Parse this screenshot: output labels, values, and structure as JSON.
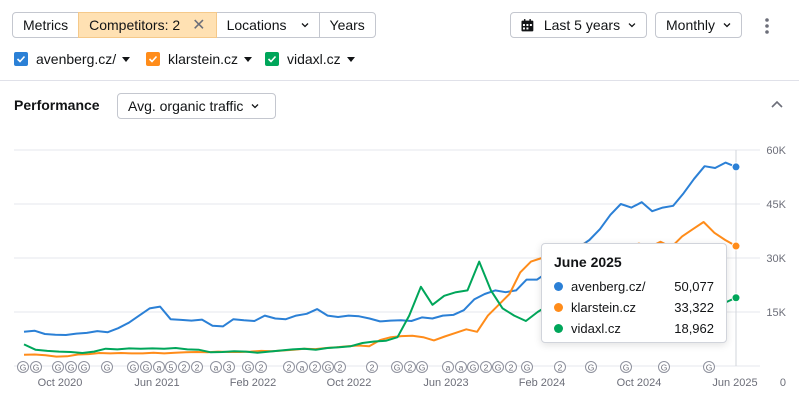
{
  "toolbar": {
    "tabs": [
      {
        "label": "Metrics"
      },
      {
        "label": "Competitors: 2"
      },
      {
        "label": "Locations"
      },
      {
        "label": "Years"
      }
    ],
    "period_label": "Last 5 years",
    "granularity_label": "Monthly"
  },
  "competitors": [
    {
      "label": "avenberg.cz/",
      "color": "#2b80d6"
    },
    {
      "label": "klarstein.cz",
      "color": "#ff8c1a"
    },
    {
      "label": "vidaxl.cz",
      "color": "#00a65a"
    }
  ],
  "performance": {
    "title": "Performance",
    "metric_label": "Avg. organic traffic"
  },
  "chart_data": {
    "type": "line",
    "x_tick_labels": [
      "Oct 2020",
      "Jun 2021",
      "Feb 2022",
      "Oct 2022",
      "Jun 2023",
      "Feb 2024",
      "Oct 2024",
      "Jun 2025"
    ],
    "y_tick_labels": [
      "0",
      "15K",
      "30K",
      "45K",
      "60K"
    ],
    "ylim": [
      0,
      60000
    ],
    "grid": true,
    "series": [
      {
        "name": "avenberg.cz/",
        "color": "#2b80d6",
        "values": [
          9500,
          9800,
          8900,
          8700,
          8600,
          9000,
          9200,
          9700,
          9400,
          10500,
          12000,
          14000,
          16000,
          16500,
          13000,
          12800,
          12600,
          12900,
          11200,
          11000,
          13000,
          12700,
          12500,
          14000,
          13200,
          13000,
          14000,
          14500,
          15800,
          14000,
          13600,
          14000,
          13800,
          13200,
          12400,
          12600,
          12700,
          12500,
          13500,
          13200,
          14000,
          14200,
          15500,
          18500,
          20000,
          21000,
          20500,
          21000,
          24000,
          24000,
          26000,
          27500,
          31000,
          33000,
          35000,
          38000,
          42000,
          45000,
          44000,
          45500,
          43000,
          44000,
          44500,
          48000,
          52000,
          55500,
          55000,
          56500,
          55300
        ]
      },
      {
        "name": "klarstein.cz",
        "color": "#ff8c1a",
        "values": [
          3100,
          3200,
          3000,
          2600,
          2700,
          3200,
          3300,
          3600,
          3500,
          3600,
          3500,
          3500,
          3700,
          3500,
          3700,
          3800,
          3900,
          3800,
          4000,
          3900,
          3900,
          4000,
          4200,
          4100,
          4300,
          4500,
          4800,
          4700,
          5000,
          5200,
          5500,
          5700,
          5500,
          7200,
          8000,
          8300,
          8400,
          8000,
          7100,
          8200,
          9200,
          10200,
          9500,
          14000,
          17000,
          20000,
          26000,
          29000,
          30000,
          29500,
          32000,
          33000,
          34000,
          32000,
          33500,
          33000,
          33000,
          34000,
          33000,
          34500,
          33000,
          36000,
          38000,
          40000,
          37000,
          35000,
          33322
        ]
      },
      {
        "name": "vidaxl.cz",
        "color": "#00a65a",
        "values": [
          6000,
          4500,
          4200,
          4000,
          3900,
          3600,
          4000,
          4800,
          4600,
          4900,
          4800,
          4900,
          4800,
          5000,
          4600,
          4500,
          3800,
          3900,
          4100,
          4000,
          3700,
          4000,
          4300,
          4600,
          4800,
          4500,
          5000,
          5200,
          5500,
          6400,
          6800,
          7000,
          8000,
          14000,
          22000,
          17000,
          19500,
          20500,
          21000,
          29000,
          21000,
          16000,
          14000,
          12500,
          15000,
          17000,
          15000,
          16500,
          17500,
          18500,
          19000,
          18000,
          18500,
          17500,
          17000,
          17000,
          16000,
          18500,
          19000,
          19000,
          17500,
          18962
        ]
      }
    ],
    "annotation_markers": [
      "G",
      "G",
      "G",
      "G",
      "G",
      "G",
      "G",
      "G",
      "a",
      "5",
      "2",
      "2",
      "a",
      "3",
      "G",
      "2",
      "2",
      "a",
      "2",
      "G",
      "2",
      "2",
      "G",
      "2",
      "G",
      "a",
      "a",
      "G",
      "2",
      "G",
      "2",
      "G",
      "2",
      "G",
      "G",
      "G",
      "G"
    ],
    "tooltip": {
      "title": "June 2025",
      "rows": [
        {
          "name": "avenberg.cz/",
          "value": "50,077",
          "color": "#2b80d6"
        },
        {
          "name": "klarstein.cz",
          "value": "33,322",
          "color": "#ff8c1a"
        },
        {
          "name": "vidaxl.cz",
          "value": "18,962",
          "color": "#00a65a"
        }
      ]
    }
  }
}
